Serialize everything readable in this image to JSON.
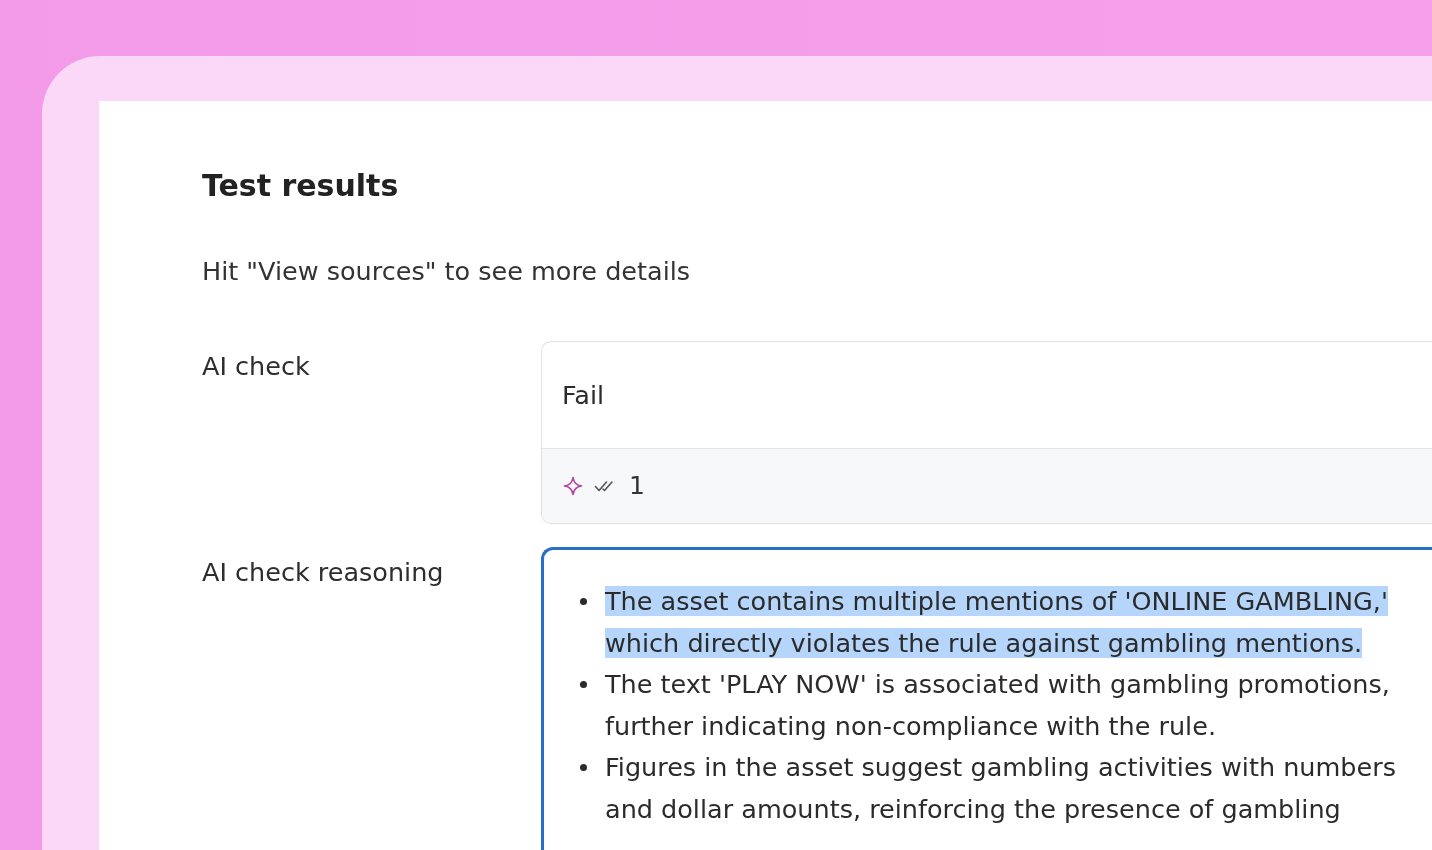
{
  "page": {
    "title": "Test results",
    "subtitle": "Hit \"View sources\" to see more details"
  },
  "fields": [
    {
      "kind": "result",
      "label": "AI check",
      "value": "Fail",
      "footer": {
        "count": "1"
      }
    },
    {
      "kind": "reasoning",
      "label": "AI check reasoning",
      "focused": true,
      "bullets": [
        {
          "text": "The asset contains multiple mentions of 'ONLINE GAMBLING,' which directly violates the rule against gambling mentions.",
          "selected": true
        },
        {
          "text": "The text 'PLAY NOW' is associated with gambling promotions, further indicating non-compliance with the rule.",
          "selected": false
        },
        {
          "text": "Figures in the asset suggest gambling activities with numbers and dollar amounts, reinforcing the presence of gambling",
          "selected": false
        }
      ]
    }
  ]
}
